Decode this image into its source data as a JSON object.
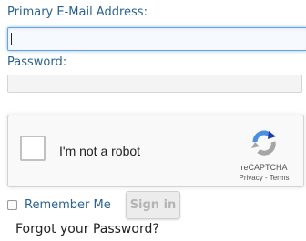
{
  "form": {
    "email_label": "Primary E-Mail Address:",
    "email_value": "",
    "password_label": "Password:",
    "password_value": "",
    "remember_label": "Remember Me",
    "signin_label": "Sign in",
    "forgot_label": "Forgot your Password?"
  },
  "recaptcha": {
    "label": "I'm not a robot",
    "brand": "reCAPTCHA",
    "privacy": "Privacy",
    "separator": " - ",
    "terms": "Terms",
    "icon": "recaptcha-logo-icon"
  },
  "colors": {
    "label_text": "#2b6390",
    "focus_border": "#6aa4dd",
    "button_disabled_text": "#b5b5b5"
  }
}
